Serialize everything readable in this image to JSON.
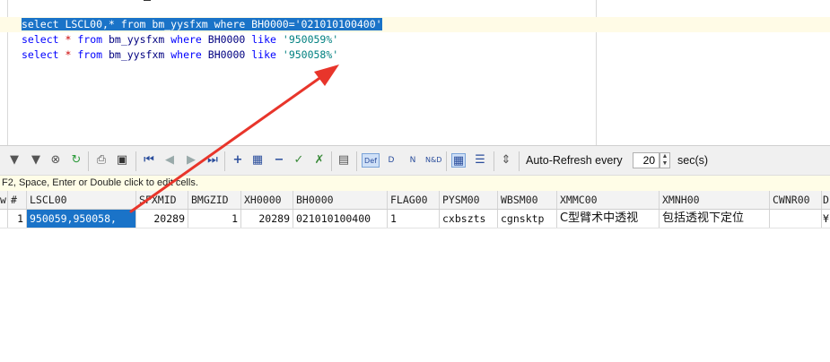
{
  "editor": {
    "lines": [
      {
        "parts": [
          {
            "text": "select LSCL00,* from bm_yysfxm where BH0000='021010100400'",
            "cls": "sel"
          }
        ]
      },
      {
        "parts": [
          {
            "text": "select",
            "cls": "kw"
          },
          {
            "text": " ",
            "cls": ""
          },
          {
            "text": "*",
            "cls": "star"
          },
          {
            "text": " ",
            "cls": ""
          },
          {
            "text": "from",
            "cls": "kw"
          },
          {
            "text": " bm_yysfxm ",
            "cls": "id"
          },
          {
            "text": "where",
            "cls": "kw"
          },
          {
            "text": " BH0000 ",
            "cls": "id"
          },
          {
            "text": "like",
            "cls": "kw"
          },
          {
            "text": " ",
            "cls": ""
          },
          {
            "text": "'950059%'",
            "cls": "str"
          }
        ]
      },
      {
        "parts": [
          {
            "text": "select",
            "cls": "kw"
          },
          {
            "text": " ",
            "cls": ""
          },
          {
            "text": "*",
            "cls": "star"
          },
          {
            "text": " ",
            "cls": ""
          },
          {
            "text": "from",
            "cls": "kw"
          },
          {
            "text": " bm_yysfxm ",
            "cls": "id"
          },
          {
            "text": "where",
            "cls": "kw"
          },
          {
            "text": " BH0000 ",
            "cls": "id"
          },
          {
            "text": "like",
            "cls": "kw"
          },
          {
            "text": " ",
            "cls": ""
          },
          {
            "text": "'950058%'",
            "cls": "str"
          }
        ]
      }
    ]
  },
  "toolbar": {
    "icons": [
      "filter-icon",
      "filter-clear-icon",
      "cancel-icon",
      "refresh-icon",
      "print-icon",
      "save-icon",
      "first-record-icon",
      "prev-record-icon",
      "next-record-icon",
      "last-record-icon",
      "insert-record-icon",
      "duplicate-record-icon",
      "delete-record-icon",
      "post-edit-icon",
      "single-record-view-icon",
      "default-value-icon",
      "null-value-icon",
      "null-default-icon",
      "grid-view-icon",
      "form-view-icon",
      "auto-refresh-icon"
    ],
    "auto_refresh_label": "Auto-Refresh every",
    "auto_refresh_value": "20",
    "auto_refresh_unit": "sec(s)"
  },
  "hint": "F2, Space, Enter or Double click to edit cells.",
  "grid": {
    "columns": [
      "#",
      "LSCL00",
      "SFXMID",
      "BMGZID",
      "XH0000",
      "BH0000",
      "FLAG00",
      "PYSM00",
      "WBSM00",
      "XMMC00",
      "XMNH00",
      "CWNR00",
      "D"
    ],
    "row_marker": "w",
    "rows": [
      [
        "1",
        "950059,950058,",
        "20289",
        "1",
        "20289",
        "021010100400",
        "1",
        "cxbszts",
        "cgnsktp",
        "C型臂术中透视",
        "包括透视下定位",
        "",
        "¥"
      ]
    ]
  },
  "colors": {
    "selection": "#1a73c8",
    "keyword": "#0000ff",
    "string": "#008080",
    "arrow": "#e8352b"
  }
}
